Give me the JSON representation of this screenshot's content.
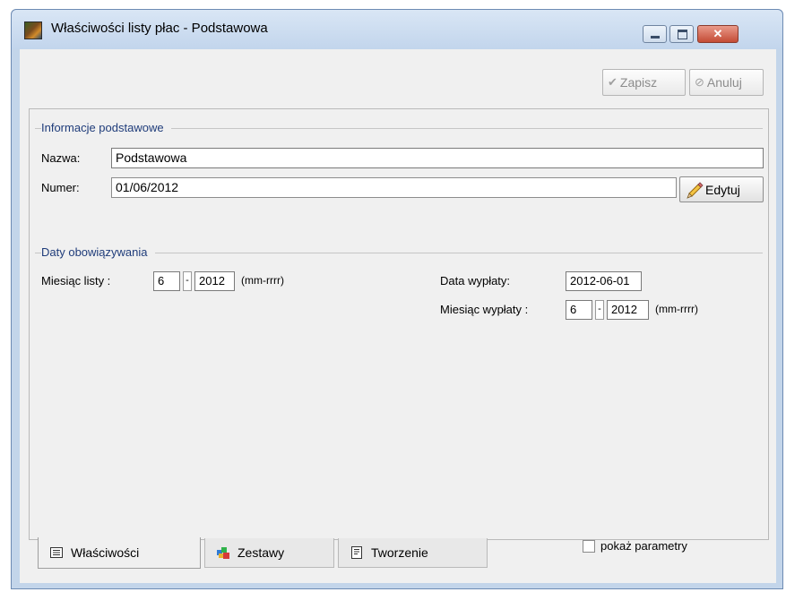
{
  "window": {
    "title": "Właściwości listy płac - Podstawowa",
    "close_glyph": "✕",
    "icons": [
      "app-icon",
      "minimize-icon",
      "maximize-icon",
      "close-icon"
    ]
  },
  "toolbar": {
    "save_label": "Zapisz",
    "cancel_label": "Anuluj",
    "save_icon": "checkmark-icon",
    "cancel_icon": "cancel-icon"
  },
  "basic_info": {
    "section_title": "Informacje podstawowe",
    "name_label": "Nazwa:",
    "name_value": "Podstawowa",
    "number_label": "Numer:",
    "number_value": "01/06/2012",
    "edit_label": "Edytuj"
  },
  "validity": {
    "section_title": "Daty obowiązywania",
    "list_month_label": "Miesiąc listy :",
    "list_month": "6",
    "list_year": "2012",
    "separator": "-",
    "format_hint": "(mm-rrrr)",
    "payout_date_label": "Data wypłaty:",
    "payout_date": "2012-06-01",
    "payout_month_label": "Miesiąc wypłaty :",
    "payout_month": "6",
    "payout_year": "2012"
  },
  "show_params": {
    "label": "pokaż parametry",
    "checked": false
  },
  "tabs": [
    {
      "label": "Właściwości",
      "icon": "properties-icon",
      "active": true
    },
    {
      "label": "Zestawy",
      "icon": "sets-icon",
      "active": false
    },
    {
      "label": "Tworzenie",
      "icon": "document-icon",
      "active": false
    }
  ],
  "colors": {
    "section_title": "#1f3c7a",
    "window_frame": "#c3d5ea",
    "close_button": "#c44b35"
  }
}
